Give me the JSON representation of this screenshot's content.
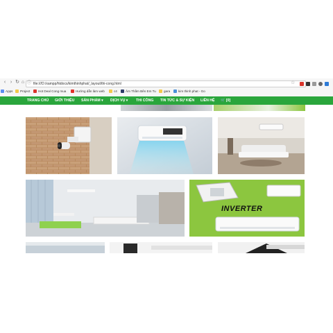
{
  "browser": {
    "url": "file:///D:/xampp/htdocs/kimthinhphat/_layout/thi-cong.html",
    "bookmarks": [
      {
        "label": "Apps",
        "color": "#5b8def"
      },
      {
        "label": "Project",
        "color": "#f2c94c"
      },
      {
        "label": "Hot Deal Cong mua",
        "color": "#d9342b"
      },
      {
        "label": "Hướng dẫn làm web",
        "color": "#e0312a"
      },
      {
        "label": "c4",
        "color": "#f2c94c"
      },
      {
        "label": "Âm Thầm Bên Em Tu",
        "color": "#2b3a67"
      },
      {
        "label": "gara",
        "color": "#f2c94c"
      },
      {
        "label": "kim thinh phat - Go",
        "color": "#4a90d9"
      }
    ]
  },
  "nav": {
    "items": [
      {
        "label": "TRANG CHỦ"
      },
      {
        "label": "GIỚI THIỆU"
      },
      {
        "label": "SẢN PHẨM ▾"
      },
      {
        "label": "DỊCH VỤ ▾"
      },
      {
        "label": "THI CÔNG"
      },
      {
        "label": "TIN TỨC & SỰ KIỆN"
      },
      {
        "label": "LIÊN HỆ"
      },
      {
        "label": "🛒 [0]"
      }
    ]
  },
  "gallery": {
    "tiles": [
      {
        "name": "security-camera-photo"
      },
      {
        "name": "air-conditioner-wall-photo"
      },
      {
        "name": "living-room-ac-photo"
      },
      {
        "name": "kitchen-dining-photo"
      },
      {
        "name": "inverter-ac-photo"
      },
      {
        "name": "ceiling-photo-1"
      },
      {
        "name": "ceiling-photo-2"
      },
      {
        "name": "ceiling-photo-3"
      }
    ],
    "inverter_text": "INVERTER"
  },
  "colors": {
    "nav_green": "#2aa63c",
    "inverter_bg": "#8cc63f"
  }
}
